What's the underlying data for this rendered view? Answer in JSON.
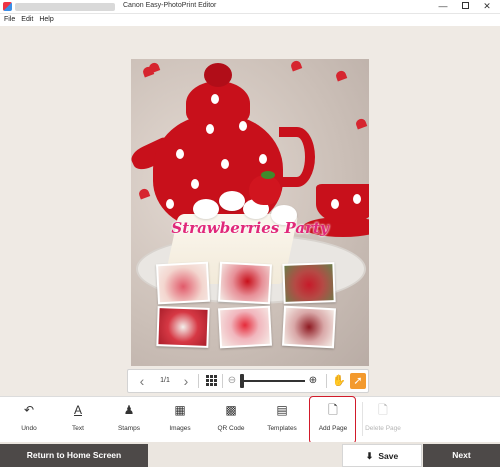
{
  "window": {
    "title": "Canon Easy-PhotoPrint Editor",
    "minimize": "—",
    "close": "✕"
  },
  "menu": [
    {
      "label": "File"
    },
    {
      "label": "Edit"
    },
    {
      "label": "Help"
    }
  ],
  "page": {
    "title": "Strawberries Party"
  },
  "view_toolbar": {
    "prev_icon": "‹",
    "page_indicator": "1/1",
    "next_icon": "›",
    "zoom_out_icon": "⊖",
    "zoom_in_icon": "⊕",
    "hand_icon": "✋",
    "pointer_icon": "➚",
    "zoom_level": 0.0
  },
  "tools": [
    {
      "label": "Undo",
      "icon": "↶",
      "icon_name": "undo-icon"
    },
    {
      "label": "Text",
      "icon": "A",
      "icon_name": "text-icon"
    },
    {
      "label": "Stamps",
      "icon": "♟",
      "icon_name": "stamp-icon"
    },
    {
      "label": "Images",
      "icon": "▦",
      "icon_name": "images-icon"
    },
    {
      "label": "QR Code",
      "icon": "▩",
      "icon_name": "qr-code-icon"
    },
    {
      "label": "Templates",
      "icon": "▤",
      "icon_name": "templates-icon"
    },
    {
      "label": "Add Page",
      "icon": "🗋",
      "icon_name": "add-page-icon"
    },
    {
      "label": "Delete Page",
      "icon": "🗋",
      "icon_name": "delete-page-icon",
      "disabled": true
    }
  ],
  "footer": {
    "home_button": "Return to Home Screen",
    "save_button": "Save",
    "save_icon": "⬇",
    "next_button": "Next"
  },
  "colors": {
    "accent_orange": "#f39a2e",
    "dark_button": "#4d4948",
    "highlight_red": "#d11a2a",
    "title_pink": "#e0287a"
  }
}
